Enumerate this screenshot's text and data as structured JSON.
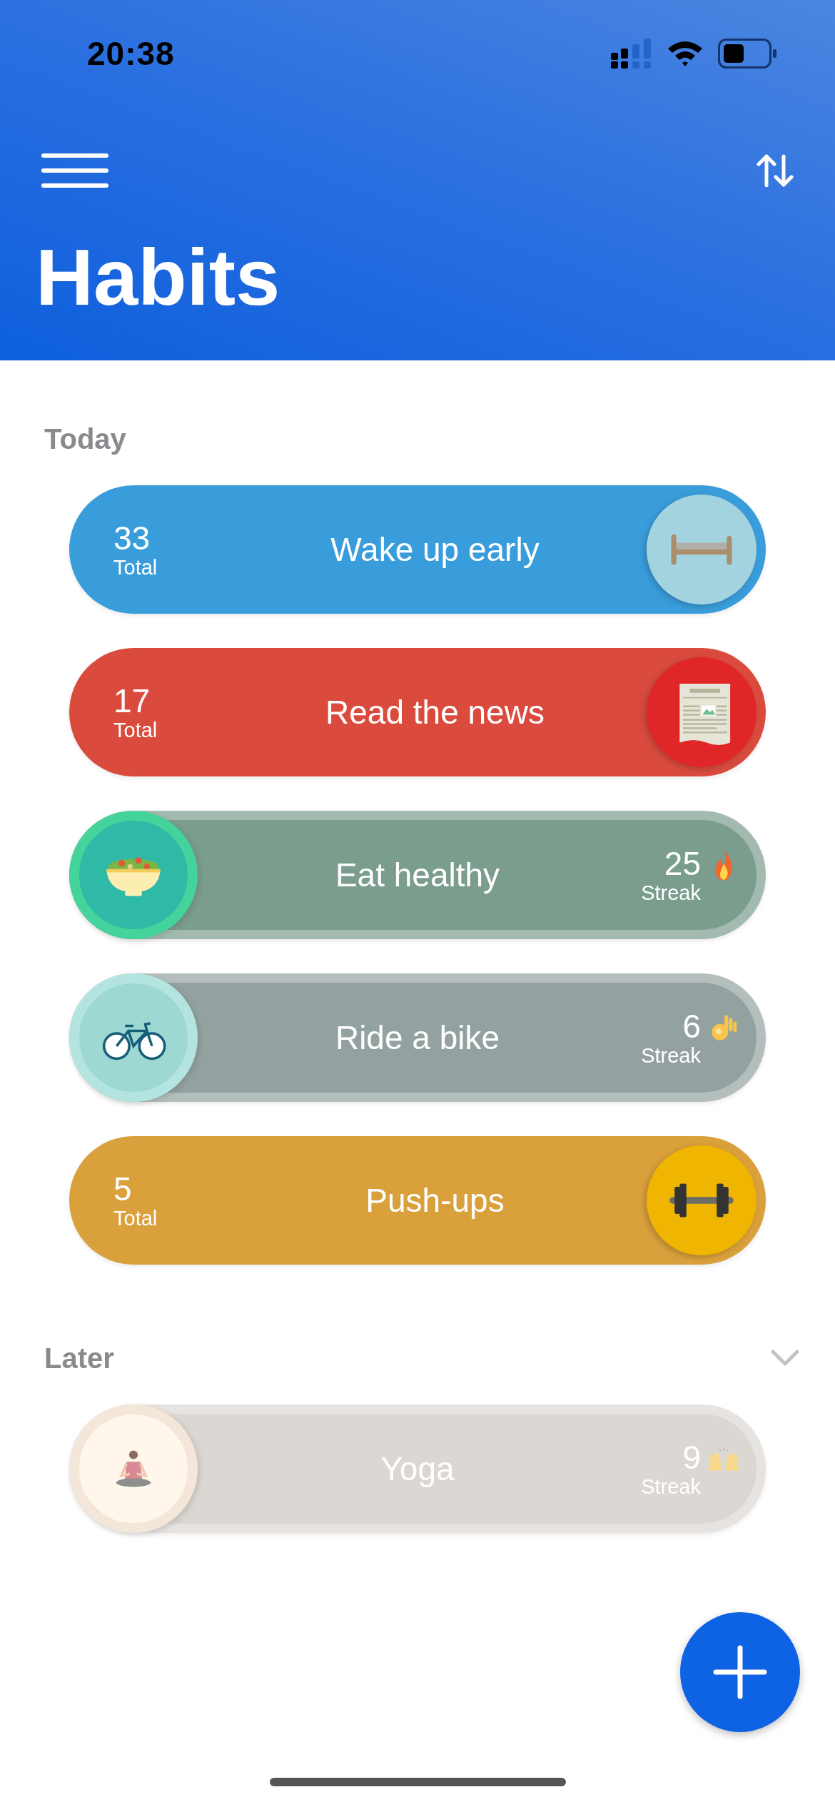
{
  "status_bar": {
    "time": "20:38"
  },
  "header": {
    "title": "Habits"
  },
  "sections": [
    {
      "title": "Today",
      "collapsible": false,
      "habits": [
        {
          "kind": "total",
          "title": "Wake up early",
          "count": "33",
          "count_label": "Total",
          "color": "#3a9ddb"
        },
        {
          "kind": "total",
          "title": "Read the news",
          "count": "17",
          "count_label": "Total",
          "color": "#da4b3e"
        },
        {
          "kind": "streak",
          "title": "Eat healthy",
          "count": "25",
          "count_label": "Streak",
          "color": "#7a9d8e"
        },
        {
          "kind": "streak",
          "title": "Ride a bike",
          "count": "6",
          "count_label": "Streak",
          "color": "#93a2a0"
        },
        {
          "kind": "total",
          "title": "Push-ups",
          "count": "5",
          "count_label": "Total",
          "color": "#daa03c"
        }
      ]
    },
    {
      "title": "Later",
      "collapsible": true,
      "habits": [
        {
          "kind": "streak",
          "title": "Yoga",
          "count": "9",
          "count_label": "Streak",
          "color": "#dbd7d3"
        }
      ]
    }
  ]
}
